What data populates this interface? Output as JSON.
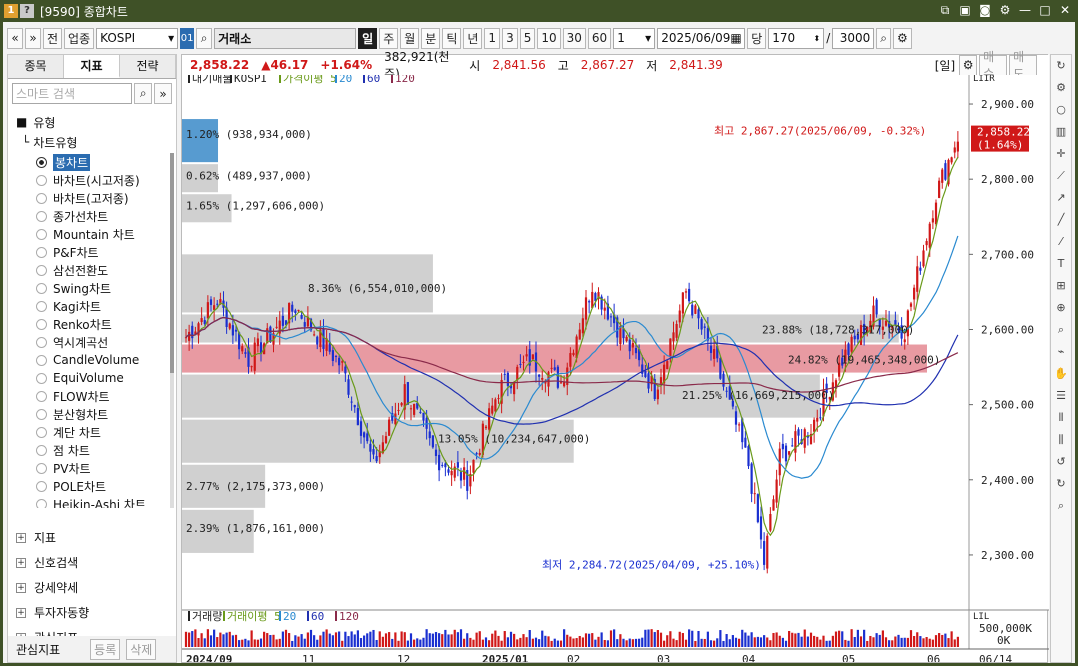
{
  "window": {
    "title": "[9590] 종합차트",
    "badge1": "1",
    "badge2": "?"
  },
  "toolbar": {
    "nav_prev": "«",
    "nav_down": "»",
    "btn_jeon": "전",
    "btn_upjong": "업종",
    "index_field": "KOSPI",
    "code_box": "01",
    "exchange": "거래소",
    "periods": [
      "일",
      "주",
      "월",
      "분",
      "틱",
      "년"
    ],
    "intervals": [
      "1",
      "3",
      "5",
      "10",
      "30",
      "60"
    ],
    "count_field": "1",
    "date_field": "2025/06/09",
    "btn_dang": "당",
    "num_field": "170",
    "slash": "/",
    "total_field": "3000"
  },
  "left_panel": {
    "tabs": [
      "종목",
      "지표",
      "전략"
    ],
    "search_placeholder": "스마트 검색",
    "section": "유형",
    "subsection": "차트유형",
    "chart_types": [
      "봉차트",
      "바차트(시고저종)",
      "바차트(고저종)",
      "종가선차트",
      "Mountain 차트",
      "P&F차트",
      "삼선전환도",
      "Swing차트",
      "Kagi차트",
      "Renko차트",
      "역시계곡선",
      "CandleVolume",
      "EquiVolume",
      "FLOW차트",
      "분산형차트",
      "계단 차트",
      "점 차트",
      "PV차트",
      "POLE차트",
      "Heikin-Ashi 차트"
    ],
    "selected_index": 0,
    "groups": [
      "지표",
      "신호검색",
      "강세약세",
      "투자자동향",
      "관심지표"
    ],
    "footer_label": "관심지표",
    "footer_add": "등록",
    "footer_del": "삭제"
  },
  "price_bar": {
    "last": "2,858.22",
    "change": "▲46.17",
    "change_pct": "+1.64%",
    "volume": "382,921(천주)",
    "open_label": "시",
    "open": "2,841.56",
    "high_label": "고",
    "high": "2,867.27",
    "low_label": "저",
    "low": "2,841.39",
    "period_badge": "[일]",
    "buy": "매수",
    "sell": "매도"
  },
  "legend": {
    "items": [
      "대기매물",
      "KOSPI",
      "가격이평 5",
      "20",
      "60",
      "120"
    ]
  },
  "volume_legend": {
    "items": [
      "거래량",
      "거래이평 5",
      "20",
      "60",
      "120"
    ]
  },
  "colors": {
    "up": "#d01818",
    "down": "#1a2fd0",
    "ma5": "#6a9a1a",
    "ma20": "#2a8ad0",
    "ma60": "#2030b0",
    "ma120": "#8a2a4a",
    "profile": "#c8c8c8",
    "profile_hi": "#e89aa2"
  },
  "annotations": {
    "high_note": "최고 2,867.27(2025/06/09, -0.32%)",
    "low_note": "최저 2,284.72(2025/04/09, +25.10%)",
    "last_price": "2,858.22",
    "last_pct": "(1.64%)"
  },
  "volume_profile": [
    {
      "label": "1.20% (938,934,000)",
      "pct": 1.2
    },
    {
      "label": "0.62% (489,937,000)",
      "pct": 0.62
    },
    {
      "label": "1.65% (1,297,606,000)",
      "pct": 1.65
    },
    {
      "label": "8.36% (6,554,010,000)",
      "pct": 8.36
    },
    {
      "label": "23.88% (18,728,317,000)",
      "pct": 23.88
    },
    {
      "label": "24.82% (19,465,348,000)",
      "pct": 24.82
    },
    {
      "label": "21.25% (16,669,215,000)",
      "pct": 21.25
    },
    {
      "label": "13.05% (10,234,647,000)",
      "pct": 13.05
    },
    {
      "label": "2.77% (2,175,373,000)",
      "pct": 2.77
    },
    {
      "label": "2.39% (1,876,161,000)",
      "pct": 2.39
    }
  ],
  "y_axis": [
    "2,900.00",
    "2,800.00",
    "2,700.00",
    "2,600.00",
    "2,500.00",
    "2,400.00",
    "2,300.00"
  ],
  "volume_axis": [
    "500,000K",
    "0K"
  ],
  "x_axis": [
    "2024/09",
    "11",
    "12",
    "2025/01",
    "02",
    "03",
    "04",
    "05",
    "06"
  ],
  "x_end": "06/14",
  "scale_badges": [
    "LIIR",
    "LIL"
  ]
}
